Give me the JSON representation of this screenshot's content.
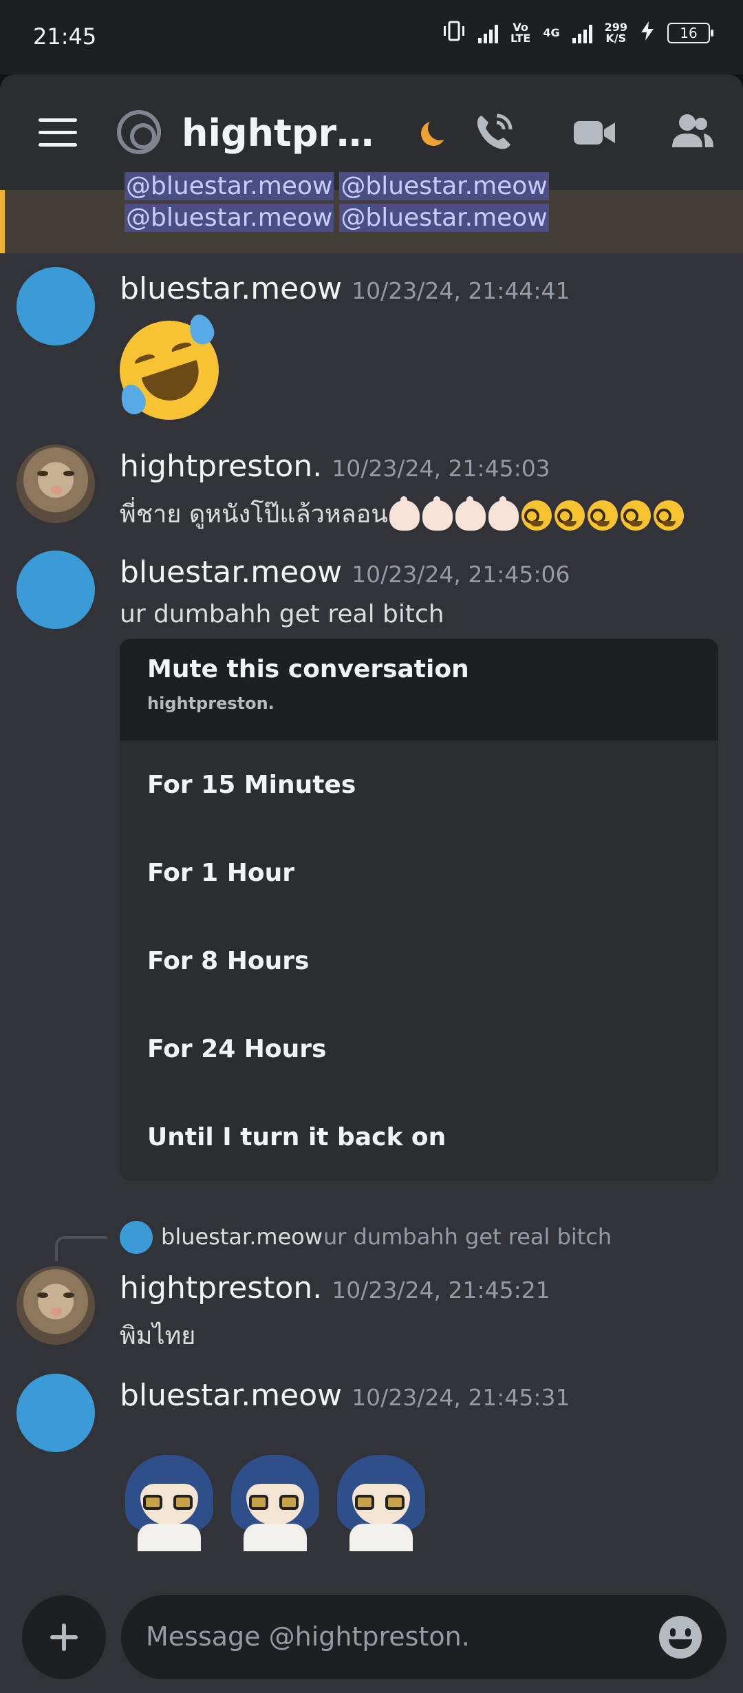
{
  "status_bar": {
    "time": "21:45",
    "network": "4G",
    "volte": "Vo",
    "volte_sub": "LTE",
    "speed": "299",
    "speed_unit": "K/S",
    "battery": "16"
  },
  "header": {
    "title": "hightpres...",
    "icons": [
      "menu-icon",
      "at-icon",
      "moon-status-icon",
      "call-icon",
      "video-icon",
      "members-icon"
    ]
  },
  "mention_strip": {
    "mentions_row1": [
      "@bluestar.meow",
      "@bluestar.meow"
    ],
    "mentions_row2": [
      "@bluestar.meow",
      "@bluestar.meow"
    ]
  },
  "messages": [
    {
      "user": "bluestar.meow",
      "timestamp": "10/23/24, 21:44:41",
      "text": "",
      "emoji": "rolling-on-floor-laughing"
    },
    {
      "user": "hightpreston.",
      "timestamp": "10/23/24, 21:45:03",
      "text": "พี่ชาย ดูหนังโป๊แล้วหลอน",
      "emoji_run": [
        "pointing-up",
        "pointing-up",
        "pointing-up",
        "pointing-up",
        "nerd-face",
        "nerd-face",
        "nerd-face",
        "nerd-face",
        "nerd-face"
      ]
    },
    {
      "user": "bluestar.meow",
      "timestamp": "10/23/24, 21:45:06",
      "text": "ur dumbahh get real bitch"
    },
    {
      "user": "hightpreston.",
      "timestamp": "10/23/24, 21:45:21",
      "text": "พิมไทย",
      "reply_to": {
        "user": "bluestar.meow",
        "text": "ur dumbahh get real bitch"
      }
    },
    {
      "user": "bluestar.meow",
      "timestamp": "10/23/24, 21:45:31",
      "text": "",
      "stickers": 3
    }
  ],
  "mute_menu": {
    "title": "Mute this conversation",
    "subtitle": "hightpreston.",
    "items": [
      "For 15 Minutes",
      "For 1 Hour",
      "For 8 Hours",
      "For 24 Hours",
      "Until I turn it back on"
    ]
  },
  "composer": {
    "placeholder": "Message @hightpreston."
  },
  "colors": {
    "background": "#313338",
    "header": "#2b2d31",
    "accent_mention": "#f0b232",
    "avatar_blue": "#3a9bd6"
  }
}
